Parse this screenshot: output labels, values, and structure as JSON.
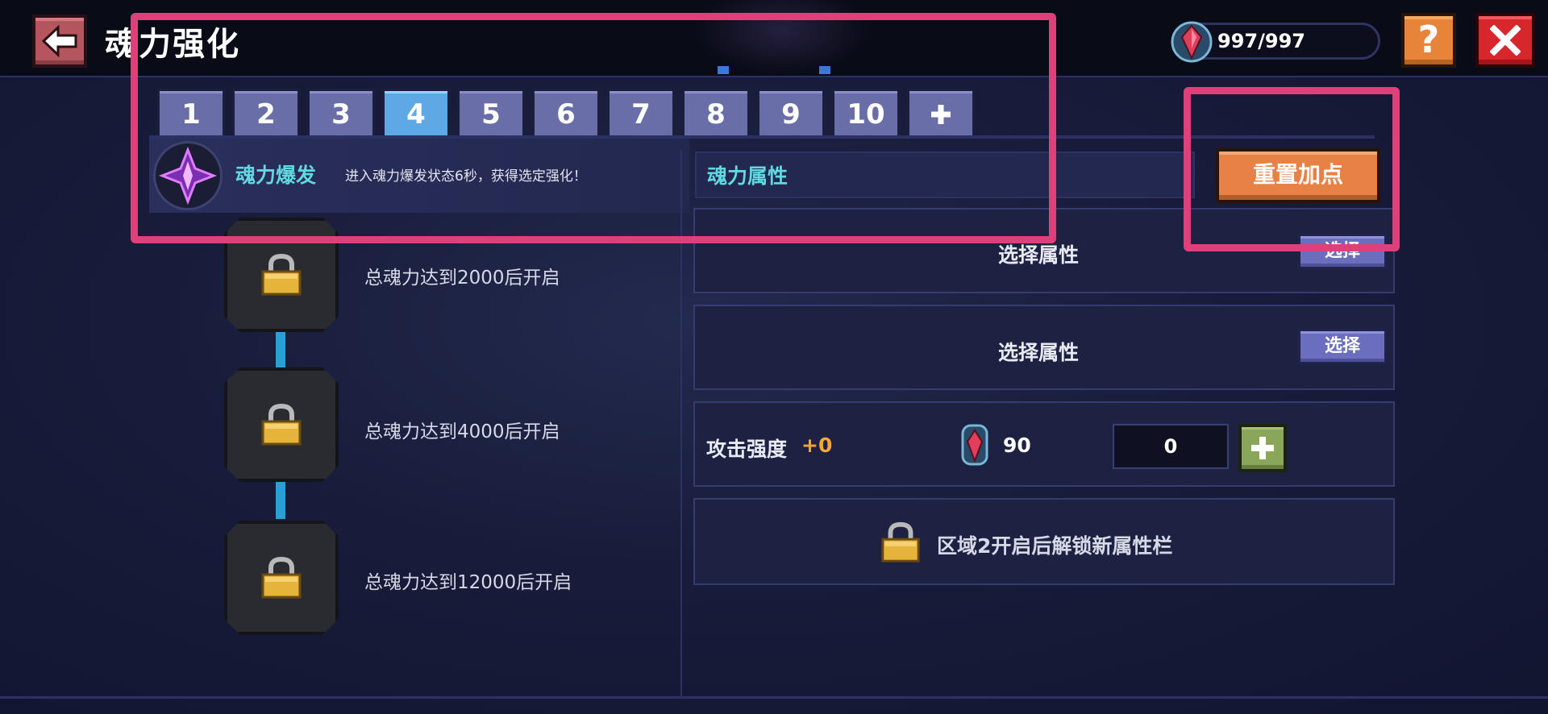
{
  "header": {
    "title": "魂力强化",
    "currency": "997/997"
  },
  "help_label": "?",
  "tabs": [
    {
      "label": "1",
      "active": false
    },
    {
      "label": "2",
      "active": false
    },
    {
      "label": "3",
      "active": false
    },
    {
      "label": "4",
      "active": true
    },
    {
      "label": "5",
      "active": false
    },
    {
      "label": "6",
      "active": false
    },
    {
      "label": "7",
      "active": false
    },
    {
      "label": "8",
      "active": false
    },
    {
      "label": "9",
      "active": false
    },
    {
      "label": "10",
      "active": false
    }
  ],
  "add_tab_icon": "plus-icon",
  "burst": {
    "name": "魂力爆发",
    "desc": "进入魂力爆发状态6秒，获得选定强化！"
  },
  "attributes": {
    "heading": "魂力属性",
    "reset_label": "重置加点",
    "slot1_label": "选择属性",
    "slot1_button": "选择",
    "slot2_label": "选择属性",
    "slot2_button": "选择",
    "stat_label": "攻击强度",
    "stat_bonus": "+0",
    "cost": "90",
    "amount": "0",
    "locked_slot_text": "区域2开启后解锁新属性栏"
  },
  "locks": [
    {
      "text": "总魂力达到2000后开启"
    },
    {
      "text": "总魂力达到4000后开启"
    },
    {
      "text": "总魂力达到12000后开启"
    }
  ],
  "colors": {
    "accent_cyan": "#5fd8e0",
    "active_tab": "#5fa8e6",
    "reset_orange": "#e88145",
    "close_red": "#d8262d",
    "highlight_pink": "#e0407a",
    "bonus_orange": "#f5a53a"
  }
}
